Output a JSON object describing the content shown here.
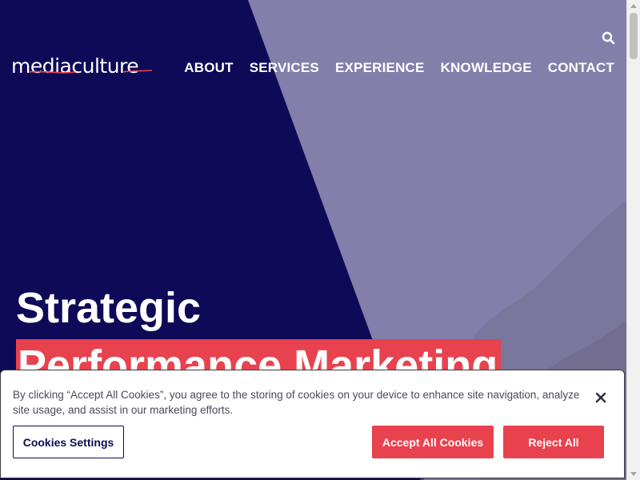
{
  "header": {
    "logo_text": "mediaculture",
    "nav": [
      {
        "label": "ABOUT"
      },
      {
        "label": "SERVICES"
      },
      {
        "label": "EXPERIENCE"
      },
      {
        "label": "KNOWLEDGE"
      },
      {
        "label": "CONTACT"
      }
    ],
    "search_icon": "search-icon"
  },
  "hero": {
    "line1": "Strategic",
    "line2": "Performance Marketing"
  },
  "cookie_banner": {
    "text": "By clicking “Accept All Cookies”, you agree to the storing of cookies on your device to enhance site navigation, analyze site usage, and assist in our marketing efforts.",
    "settings_label": "Cookies Settings",
    "accept_label": "Accept All Cookies",
    "reject_label": "Reject All",
    "close_icon": "close-icon"
  },
  "colors": {
    "navy": "#0e0a57",
    "lavender": "#8280aa",
    "accent_red": "#e8424e"
  }
}
